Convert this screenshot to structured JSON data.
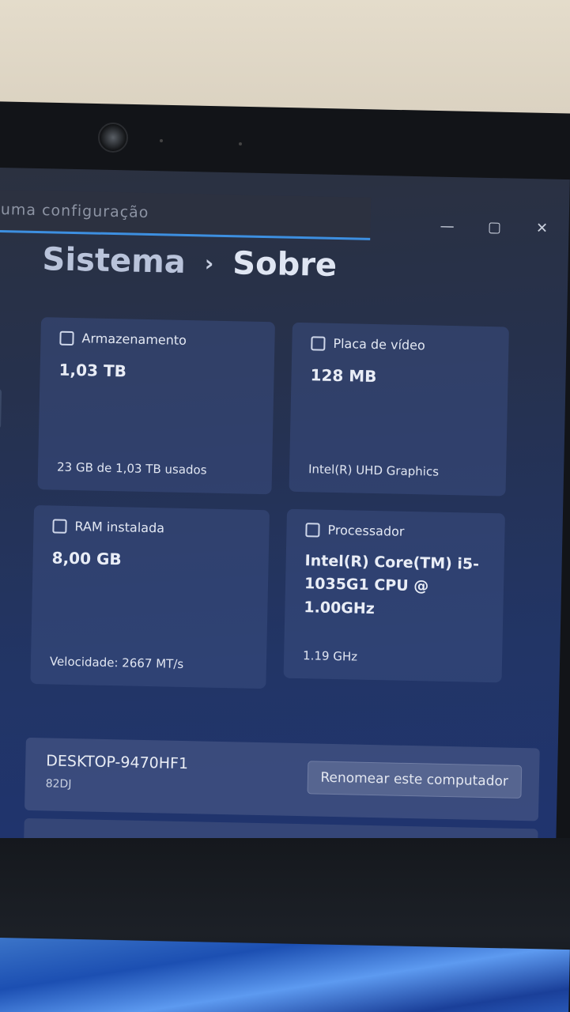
{
  "search": {
    "placeholder": "uma configuração"
  },
  "window_controls": {
    "minimize": "—",
    "maximize": "▢",
    "close": "✕"
  },
  "breadcrumb": {
    "parent": "Sistema",
    "separator": "›",
    "current": "Sobre"
  },
  "cards": {
    "storage": {
      "title": "Armazenamento",
      "value": "1,03 TB",
      "detail": "23 GB de 1,03 TB usados",
      "icon": "storage-icon"
    },
    "gpu": {
      "title": "Placa de vídeo",
      "value": "128 MB",
      "detail": "Intel(R) UHD Graphics",
      "icon": "gpu-icon"
    },
    "ram": {
      "title": "RAM instalada",
      "value": "8,00 GB",
      "detail": "Velocidade: 2667 MT/s",
      "icon": "ram-icon"
    },
    "cpu": {
      "title": "Processador",
      "value": "Intel(R) Core(TM) i5-1035G1 CPU @ 1.00GHz",
      "detail": "1.19 GHz",
      "icon": "cpu-icon"
    }
  },
  "device": {
    "name": "DESKTOP-9470HF1",
    "model": "82DJ",
    "rename_label": "Renomear este computador"
  }
}
